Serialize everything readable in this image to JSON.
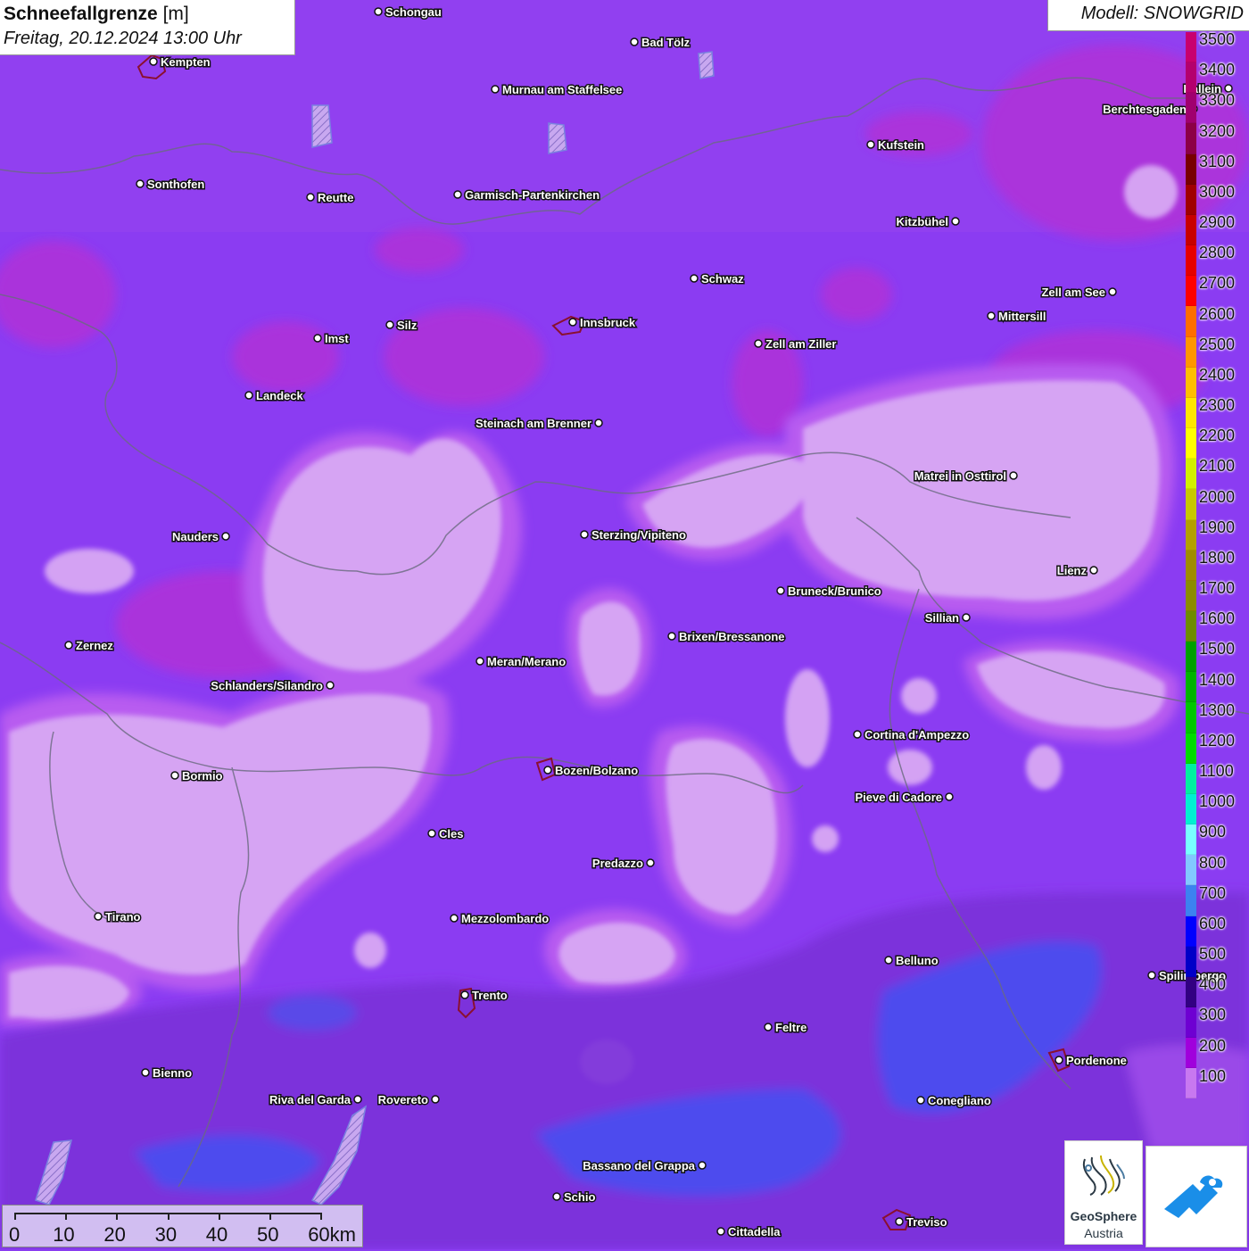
{
  "header": {
    "title": "Schneefallgrenze",
    "unit": "[m]",
    "datetime": "Freitag, 20.12.2024 13:00 Uhr",
    "model": "Modell: SNOWGRID"
  },
  "legend": {
    "levels": [
      "3500",
      "3400",
      "3300",
      "3200",
      "3100",
      "3000",
      "2900",
      "2800",
      "2700",
      "2600",
      "2500",
      "2400",
      "2300",
      "2200",
      "2100",
      "2000",
      "1900",
      "1800",
      "1700",
      "1600",
      "1500",
      "1400",
      "1300",
      "1200",
      "1100",
      "1000",
      "900",
      "800",
      "700",
      "600",
      "500",
      "400",
      "300",
      "200",
      "100"
    ],
    "colors": [
      "#c8006e",
      "#b4006e",
      "#a0006e",
      "#8c0046",
      "#780000",
      "#a00000",
      "#c80000",
      "#e60000",
      "#ff0000",
      "#ff6e00",
      "#ff9600",
      "#ffbe00",
      "#ffe600",
      "#ffff00",
      "#d2f000",
      "#c8c800",
      "#b4a000",
      "#a08c00",
      "#8c8c00",
      "#6e8c00",
      "#00a000",
      "#00b400",
      "#00c800",
      "#00dc00",
      "#00f0a0",
      "#00f0d2",
      "#78ffff",
      "#82c8ff",
      "#3c82f0",
      "#0000ff",
      "#0000c8",
      "#320082",
      "#6e00d2",
      "#a000dc",
      "#c878f0"
    ]
  },
  "cities": [
    {
      "name": "Schongau",
      "label_side": "right"
    },
    {
      "name": "Kempten",
      "label_side": "right"
    },
    {
      "name": "Bad Tölz",
      "label_side": "right"
    },
    {
      "name": "Murnau am Staffelsee",
      "label_side": "right"
    },
    {
      "name": "Hallein",
      "label_side": "left"
    },
    {
      "name": "Berchtesgaden",
      "label_side": "left"
    },
    {
      "name": "Kufstein",
      "label_side": "right"
    },
    {
      "name": "Sonthofen",
      "label_side": "right"
    },
    {
      "name": "Reutte",
      "label_side": "right"
    },
    {
      "name": "Garmisch-Partenkirchen",
      "label_side": "right"
    },
    {
      "name": "Kitzbühel",
      "label_side": "left"
    },
    {
      "name": "Schwaz",
      "label_side": "right"
    },
    {
      "name": "Zell am See",
      "label_side": "left"
    },
    {
      "name": "Mittersill",
      "label_side": "right"
    },
    {
      "name": "Innsbruck",
      "label_side": "right"
    },
    {
      "name": "Silz",
      "label_side": "right"
    },
    {
      "name": "Imst",
      "label_side": "right"
    },
    {
      "name": "Zell am Ziller",
      "label_side": "right"
    },
    {
      "name": "Landeck",
      "label_side": "right"
    },
    {
      "name": "Steinach am Brenner",
      "label_side": "left"
    },
    {
      "name": "Matrei in Osttirol",
      "label_side": "left"
    },
    {
      "name": "Nauders",
      "label_side": "left"
    },
    {
      "name": "Sterzing/Vipiteno",
      "label_side": "right"
    },
    {
      "name": "Lienz",
      "label_side": "left"
    },
    {
      "name": "Bruneck/Brunico",
      "label_side": "right"
    },
    {
      "name": "Sillian",
      "label_side": "left"
    },
    {
      "name": "Zernez",
      "label_side": "right"
    },
    {
      "name": "Brixen/Bressanone",
      "label_side": "right"
    },
    {
      "name": "Meran/Merano",
      "label_side": "right"
    },
    {
      "name": "Schlanders/Silandro",
      "label_side": "left"
    },
    {
      "name": "Cortina d'Ampezzo",
      "label_side": "right"
    },
    {
      "name": "Bormio",
      "label_side": "right"
    },
    {
      "name": "Bozen/Bolzano",
      "label_side": "right"
    },
    {
      "name": "Pieve di Cadore",
      "label_side": "left"
    },
    {
      "name": "Cles",
      "label_side": "right"
    },
    {
      "name": "Predazzo",
      "label_side": "left"
    },
    {
      "name": "Tirano",
      "label_side": "right"
    },
    {
      "name": "Mezzolombardo",
      "label_side": "right"
    },
    {
      "name": "Belluno",
      "label_side": "right"
    },
    {
      "name": "Spilimbergo",
      "label_side": "right"
    },
    {
      "name": "Trento",
      "label_side": "right"
    },
    {
      "name": "Feltre",
      "label_side": "right"
    },
    {
      "name": "Pordenone",
      "label_side": "right"
    },
    {
      "name": "Bienno",
      "label_side": "right"
    },
    {
      "name": "Riva del Garda",
      "label_side": "left"
    },
    {
      "name": "Rovereto",
      "label_side": "left"
    },
    {
      "name": "Conegliano",
      "label_side": "right"
    },
    {
      "name": "Bassano del Grappa",
      "label_side": "left"
    },
    {
      "name": "Schio",
      "label_side": "right"
    },
    {
      "name": "Treviso",
      "label_side": "right"
    },
    {
      "name": "Cittadella",
      "label_side": "right"
    }
  ],
  "scale": {
    "labels": [
      "0",
      "10",
      "20",
      "30",
      "40",
      "50",
      "60km"
    ]
  },
  "logos": {
    "geosphere_name": "GeoSphere",
    "geosphere_sub": "Austria"
  }
}
